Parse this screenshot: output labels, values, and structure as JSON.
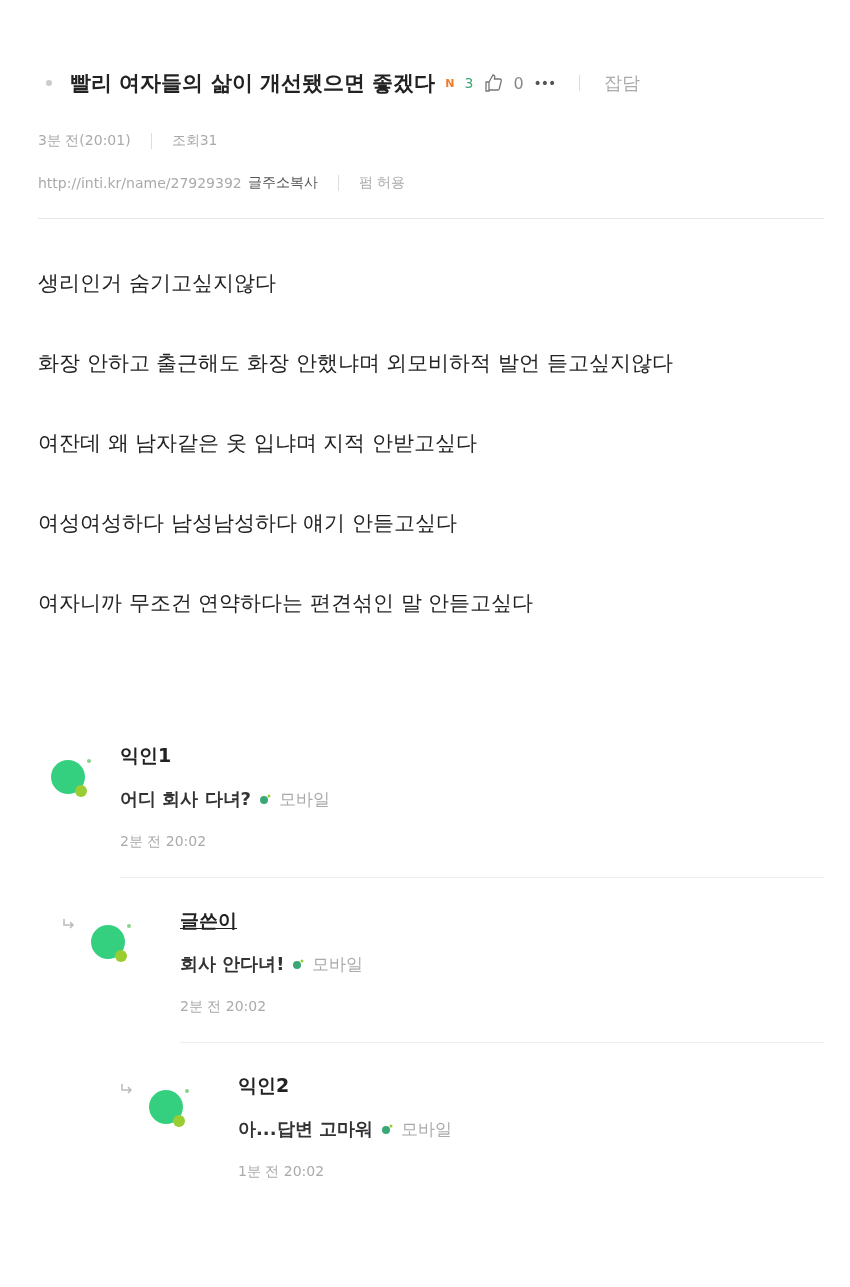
{
  "post": {
    "title": "빨리 여자들의 삶이 개선됐으면 좋겠다",
    "new_badge": "N",
    "comment_count": "3",
    "likes": "0",
    "more": "•••",
    "category": "잡담",
    "time": "3분 전(20:01)",
    "views": "조회31",
    "url": "http://inti.kr/name/27929392",
    "copy_link": "글주소복사",
    "share": "펌 허용",
    "body": [
      "생리인거 숨기고싶지않다",
      "화장 안하고 출근해도 화장 안했냐며 외모비하적 발언 듣고싶지않다",
      "여잔데 왜 남자같은 옷 입냐며 지적 안받고싶다",
      "여성여성하다 남성남성하다 얘기 안듣고싶다",
      "여자니까 무조건 연약하다는 편견섞인 말 안듣고싶다"
    ]
  },
  "comments": [
    {
      "author": "익인1",
      "is_writer": false,
      "text": "어디 회사 다녀?",
      "device": "모바일",
      "time": "2분 전 20:02",
      "children": [
        {
          "author": "글쓴이",
          "is_writer": true,
          "text": "회사 안다녀!",
          "device": "모바일",
          "time": "2분 전 20:02",
          "children": [
            {
              "author": "익인2",
              "is_writer": false,
              "text": "아...답변 고마워",
              "device": "모바일",
              "time": "1분 전 20:02"
            }
          ]
        }
      ]
    }
  ]
}
